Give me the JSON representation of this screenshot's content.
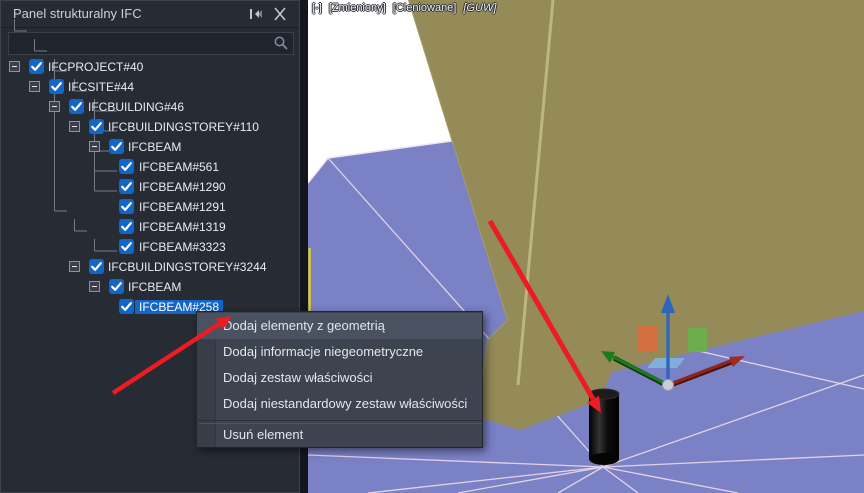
{
  "panel": {
    "title": "Panel strukturalny IFC",
    "search": {
      "value": "",
      "placeholder": ""
    }
  },
  "tree": {
    "items": [
      {
        "label": "IFCPROJECT#40",
        "level": 0,
        "expandable": true,
        "checked": true,
        "selected": false
      },
      {
        "label": "IFCSITE#44",
        "level": 1,
        "expandable": true,
        "checked": true,
        "selected": false
      },
      {
        "label": "IFCBUILDING#46",
        "level": 2,
        "expandable": true,
        "checked": true,
        "selected": false
      },
      {
        "label": "IFCBUILDINGSTOREY#110",
        "level": 3,
        "expandable": true,
        "checked": true,
        "selected": false
      },
      {
        "label": "IFCBEAM",
        "level": 4,
        "expandable": true,
        "checked": true,
        "selected": false
      },
      {
        "label": "IFCBEAM#561",
        "level": 5,
        "expandable": false,
        "checked": true,
        "selected": false
      },
      {
        "label": "IFCBEAM#1290",
        "level": 5,
        "expandable": false,
        "checked": true,
        "selected": false
      },
      {
        "label": "IFCBEAM#1291",
        "level": 5,
        "expandable": false,
        "checked": true,
        "selected": false
      },
      {
        "label": "IFCBEAM#1319",
        "level": 5,
        "expandable": false,
        "checked": true,
        "selected": false
      },
      {
        "label": "IFCBEAM#3323",
        "level": 5,
        "expandable": false,
        "checked": true,
        "selected": false
      },
      {
        "label": "IFCBUILDINGSTOREY#3244",
        "level": 3,
        "expandable": true,
        "checked": true,
        "selected": false
      },
      {
        "label": "IFCBEAM",
        "level": 4,
        "expandable": true,
        "checked": true,
        "selected": false
      },
      {
        "label": "IFCBEAM#258",
        "level": 5,
        "expandable": false,
        "checked": true,
        "selected": true
      }
    ]
  },
  "context_menu": {
    "items": [
      {
        "label": "Dodaj elementy z geometrią",
        "highlighted": true
      },
      {
        "label": "Dodaj informacje niegeometryczne",
        "highlighted": false
      },
      {
        "label": "Dodaj zestaw właściwości",
        "highlighted": false
      },
      {
        "label": "Dodaj niestandardowy zestaw właściwości",
        "highlighted": false
      },
      {
        "label": "Usuń element",
        "highlighted": false
      }
    ],
    "separator_before": "Usuń element"
  },
  "viewport": {
    "status_parts": [
      "[-]",
      "[Zmieniony]",
      "[Cieniowane]",
      "[GUW]"
    ]
  },
  "colors": {
    "selection_blue": "#1266c8",
    "checkbox_blue": "#1266c8",
    "annotation_red": "#ec1b24",
    "beam_olive": "#948b58",
    "ground_plane": "#7a81c5",
    "menu_bg": "#3e4350",
    "panel_bg": "#272b34",
    "axis_x_red": "#8f261d",
    "axis_y_green": "#1c7a1c",
    "axis_z_blue": "#2f66bd"
  }
}
